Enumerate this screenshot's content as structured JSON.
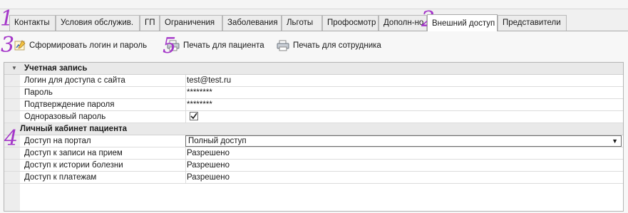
{
  "tabs": [
    "Контакты",
    "Условия обслужив.",
    "ГП",
    "Ограничения",
    "Заболевания",
    "Льготы",
    "Профосмотр",
    "Дополн-но",
    "Внешний доступ",
    "Представители"
  ],
  "active_tab": "Внешний доступ",
  "toolbar": {
    "generate_label": "Сформировать логин и пароль",
    "print_patient_label": "Печать для пациента",
    "print_employee_label": "Печать для сотрудника"
  },
  "account": {
    "section_title": "Учетная запись",
    "rows": [
      {
        "label": "Логин для доступа с сайта",
        "value": "test@test.ru"
      },
      {
        "label": "Пароль",
        "value": "********"
      },
      {
        "label": "Подтверждение пароля",
        "value": "********"
      },
      {
        "label": "Одноразовый пароль",
        "checked": true
      }
    ]
  },
  "cabinet": {
    "section_title": "Личный кабинет пациента",
    "rows": [
      {
        "label": "Доступ на портал",
        "value": "Полный доступ"
      },
      {
        "label": "Доступ к записи на прием",
        "value": "Разрешено"
      },
      {
        "label": "Доступ к истории болезни",
        "value": "Разрешено"
      },
      {
        "label": "Доступ к платежам",
        "value": "Разрешено"
      }
    ]
  },
  "annotations": [
    "1",
    "2",
    "3",
    "4",
    "5"
  ],
  "colors": {
    "annotation": "#a436c9",
    "active_tab": "#ffffff"
  }
}
